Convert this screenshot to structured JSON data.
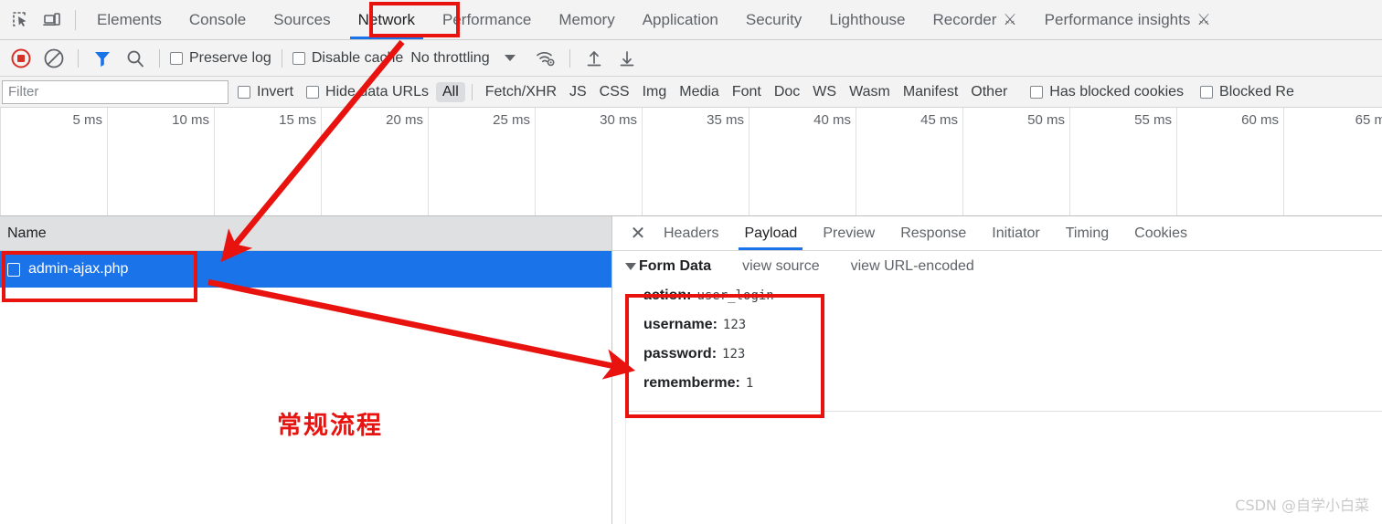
{
  "tabbar": {
    "inspect_icon": "inspect-element-icon",
    "device_icon": "device-toolbar-icon",
    "tabs": [
      {
        "label": "Elements",
        "active": false,
        "beaker": false
      },
      {
        "label": "Console",
        "active": false,
        "beaker": false
      },
      {
        "label": "Sources",
        "active": false,
        "beaker": false
      },
      {
        "label": "Network",
        "active": true,
        "beaker": false
      },
      {
        "label": "Performance",
        "active": false,
        "beaker": false
      },
      {
        "label": "Memory",
        "active": false,
        "beaker": false
      },
      {
        "label": "Application",
        "active": false,
        "beaker": false
      },
      {
        "label": "Security",
        "active": false,
        "beaker": false
      },
      {
        "label": "Lighthouse",
        "active": false,
        "beaker": false
      },
      {
        "label": "Recorder",
        "active": false,
        "beaker": true
      },
      {
        "label": "Performance insights",
        "active": false,
        "beaker": true
      }
    ]
  },
  "toolbar": {
    "record_icon": "record-stop-icon",
    "clear_icon": "clear-icon",
    "filter_icon": "filter-funnel-icon",
    "search_icon": "search-icon",
    "preserve_log_label": "Preserve log",
    "preserve_log_checked": false,
    "disable_cache_label": "Disable cache",
    "disable_cache_checked": false,
    "throttling_value": "No throttling",
    "network_conditions_icon": "wifi-settings-icon",
    "import_icon": "import-har-icon",
    "export_icon": "export-har-icon"
  },
  "filterbar": {
    "filter_placeholder": "Filter",
    "filter_value": "",
    "invert_label": "Invert",
    "invert_checked": false,
    "hide_data_urls_label": "Hide data URLs",
    "hide_data_urls_checked": false,
    "types": [
      {
        "label": "All",
        "selected": true
      },
      {
        "label": "Fetch/XHR",
        "selected": false
      },
      {
        "label": "JS",
        "selected": false
      },
      {
        "label": "CSS",
        "selected": false
      },
      {
        "label": "Img",
        "selected": false
      },
      {
        "label": "Media",
        "selected": false
      },
      {
        "label": "Font",
        "selected": false
      },
      {
        "label": "Doc",
        "selected": false
      },
      {
        "label": "WS",
        "selected": false
      },
      {
        "label": "Wasm",
        "selected": false
      },
      {
        "label": "Manifest",
        "selected": false
      },
      {
        "label": "Other",
        "selected": false
      }
    ],
    "has_blocked_cookies_label": "Has blocked cookies",
    "has_blocked_cookies_checked": false,
    "blocked_requests_label": "Blocked Re",
    "blocked_requests_checked": false
  },
  "overview": {
    "ticks": [
      "5 ms",
      "10 ms",
      "15 ms",
      "20 ms",
      "25 ms",
      "30 ms",
      "35 ms",
      "40 ms",
      "45 ms",
      "50 ms",
      "55 ms",
      "60 ms",
      "65 m"
    ]
  },
  "requests": {
    "column_name": "Name",
    "rows": [
      {
        "name": "admin-ajax.php",
        "selected": true,
        "icon": "document-icon"
      }
    ]
  },
  "details": {
    "close_icon": "close-icon",
    "tabs": [
      {
        "label": "Headers",
        "active": false
      },
      {
        "label": "Payload",
        "active": true
      },
      {
        "label": "Preview",
        "active": false
      },
      {
        "label": "Response",
        "active": false
      },
      {
        "label": "Initiator",
        "active": false
      },
      {
        "label": "Timing",
        "active": false
      },
      {
        "label": "Cookies",
        "active": false
      }
    ],
    "section_title": "Form Data",
    "view_source_label": "view source",
    "view_url_encoded_label": "view URL-encoded",
    "form_data": [
      {
        "key": "action:",
        "value": "user_login"
      },
      {
        "key": "username:",
        "value": "123"
      },
      {
        "key": "password:",
        "value": "123"
      },
      {
        "key": "rememberme:",
        "value": "1"
      }
    ]
  },
  "annotations": {
    "callout_text": "常规流程",
    "box_color": "#e8120e",
    "arrow_color": "#e8120e"
  },
  "watermark": {
    "text": "CSDN @自学小白菜"
  }
}
